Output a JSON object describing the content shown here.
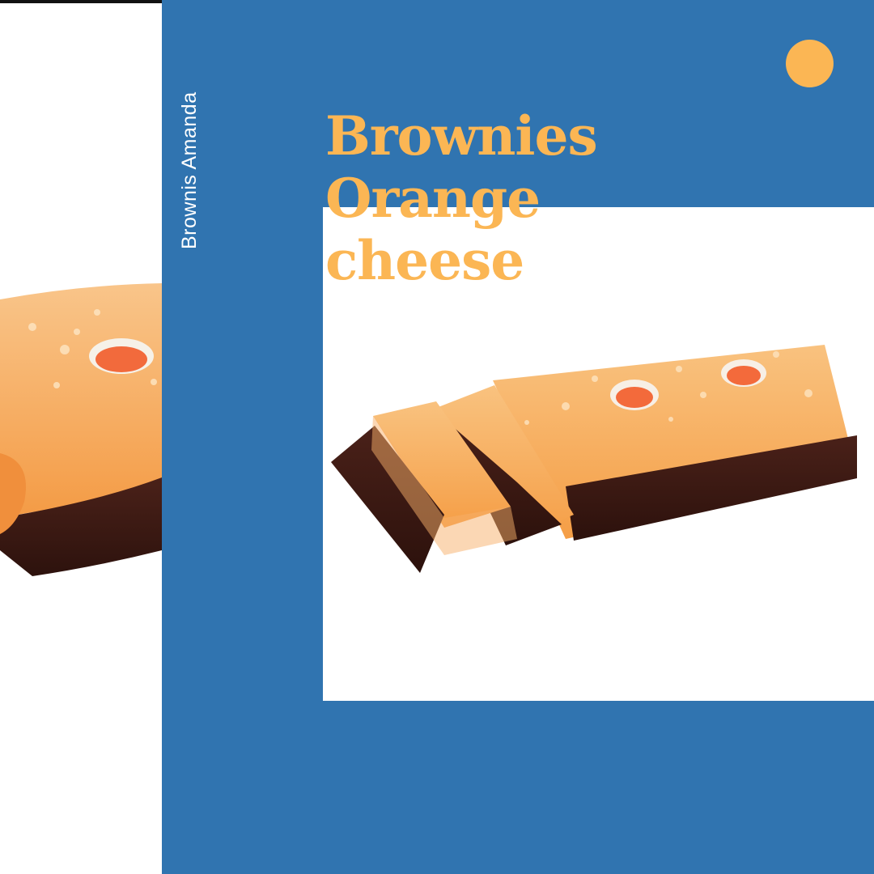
{
  "brand": "Brownis Amanda",
  "title_lines": [
    "Brownies",
    "Orange",
    "cheese"
  ],
  "colors": {
    "panel_blue": "#3074b0",
    "accent_orange": "#fbb654",
    "white": "#ffffff",
    "chocolate": "#3e1a14",
    "orange_sponge": "#f6a65a"
  },
  "images": {
    "left_crop": "brownie-cake-closeup",
    "main": "sliced-orange-cheese-brownie"
  }
}
